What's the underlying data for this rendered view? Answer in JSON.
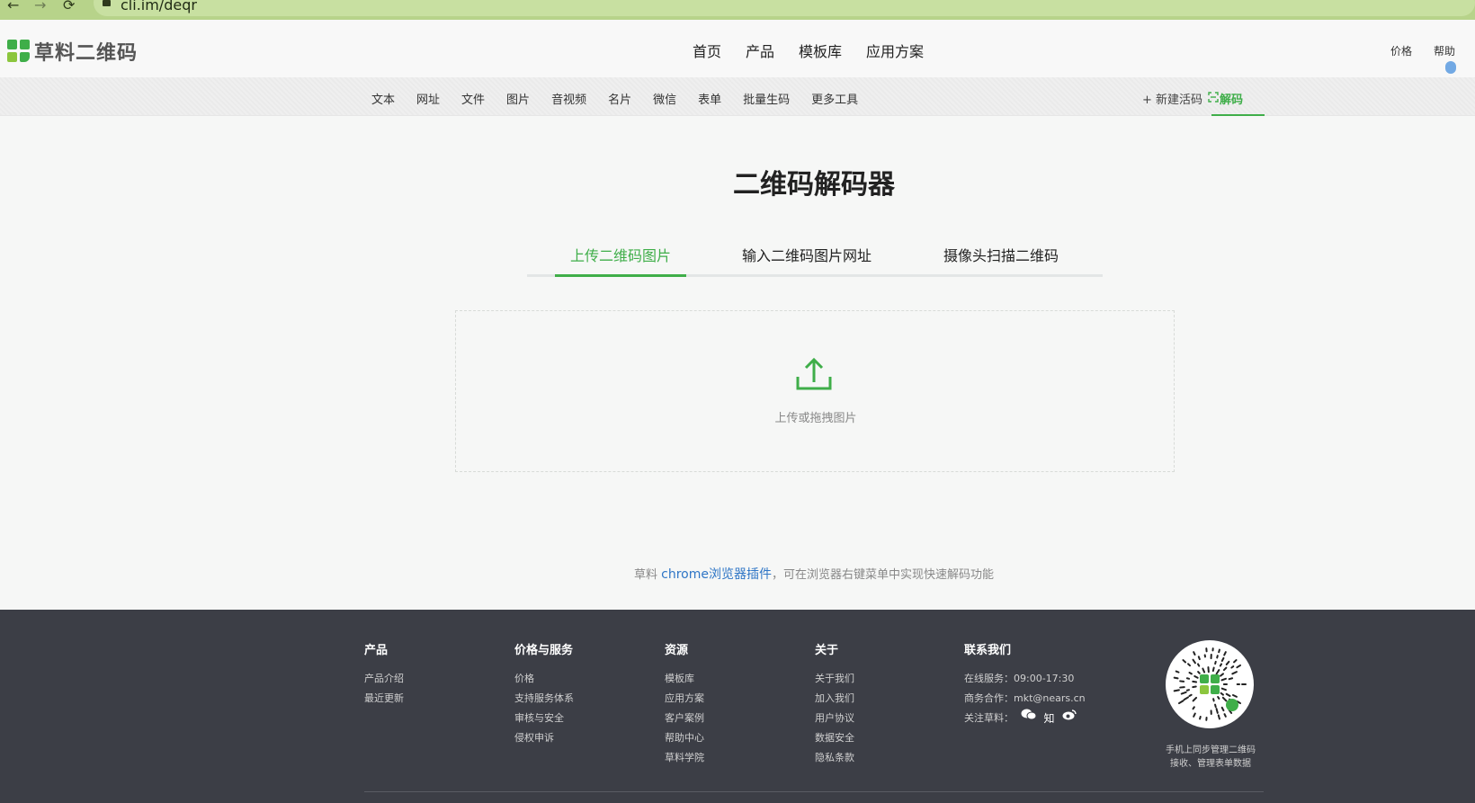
{
  "browser": {
    "url": "cli.im/deqr",
    "back_icon": "arrow-left-icon",
    "forward_icon": "arrow-right-icon",
    "reload_icon": "reload-icon",
    "lock_icon": "lock-icon"
  },
  "header": {
    "logo_text": "草料二维码",
    "nav": [
      "首页",
      "产品",
      "模板库",
      "应用方案"
    ],
    "price": "价格",
    "help": "帮助"
  },
  "subnav": {
    "items": [
      "文本",
      "网址",
      "文件",
      "图片",
      "音视频",
      "名片",
      "微信",
      "表单",
      "批量生码",
      "更多工具"
    ],
    "new_qr": "+ 新建活码",
    "decode": "解码"
  },
  "main": {
    "title": "二维码解码器",
    "tabs": [
      "上传二维码图片",
      "输入二维码图片网址",
      "摄像头扫描二维码"
    ],
    "active_tab": 0,
    "upload_text": "上传或拖拽图片",
    "plugin_prefix": "草料",
    "plugin_link": "chrome浏览器插件",
    "plugin_suffix": "，可在浏览器右键菜单中实现快速解码功能"
  },
  "footer": {
    "columns": [
      {
        "title": "产品",
        "links": [
          "产品介绍",
          "最近更新"
        ]
      },
      {
        "title": "价格与服务",
        "links": [
          "价格",
          "支持服务体系",
          "审核与安全",
          "侵权申诉"
        ]
      },
      {
        "title": "资源",
        "links": [
          "模板库",
          "应用方案",
          "客户案例",
          "帮助中心",
          "草料学院"
        ]
      },
      {
        "title": "关于",
        "links": [
          "关于我们",
          "加入我们",
          "用户协议",
          "数据安全",
          "隐私条款"
        ]
      }
    ],
    "contact": {
      "title": "联系我们",
      "online": "在线服务：09:00-17:30",
      "business": "商务合作：mkt@nears.cn",
      "follow": "关注草料：",
      "social_icons": [
        "wechat-icon",
        "zhihu-icon",
        "weibo-icon"
      ],
      "zhihu_glyph": "知"
    },
    "qr_caption_1": "手机上同步管理二维码",
    "qr_caption_2": "接收、管理表单数据"
  },
  "colors": {
    "brand_green": "#3fae49",
    "footer_bg": "#3c3e46",
    "link_blue": "#2f76c6"
  }
}
